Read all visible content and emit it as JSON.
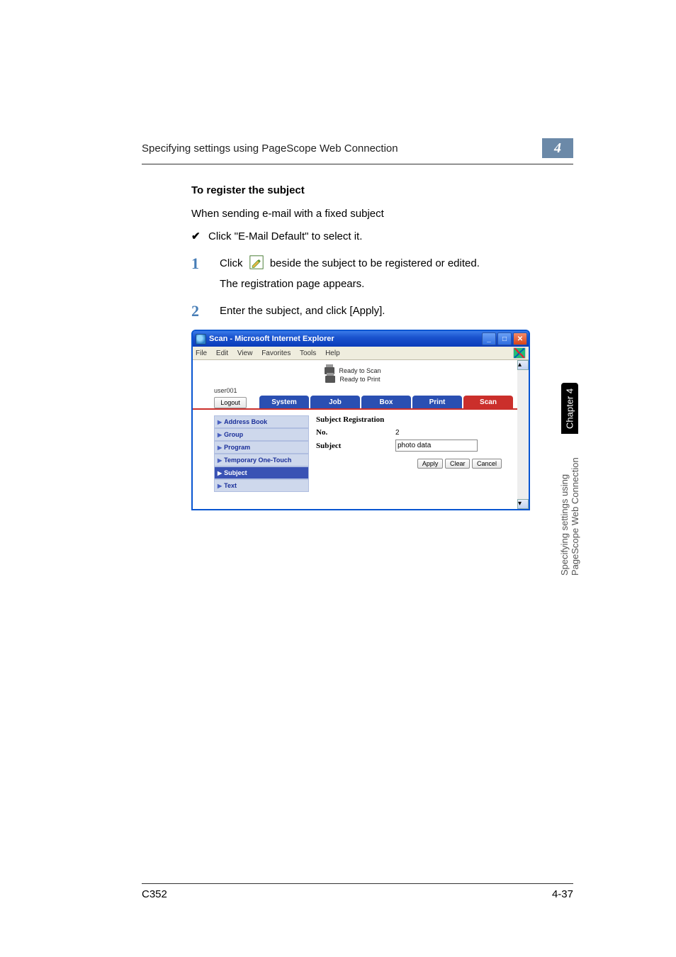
{
  "header": {
    "running_head": "Specifying settings using PageScope Web Connection",
    "chapter_num": "4"
  },
  "doc": {
    "section_title": "To register the subject",
    "intro": "When sending e-mail with a fixed subject",
    "check_text": "Click \"E-Mail Default\" to select it.",
    "step1_a": "Click ",
    "step1_b": " beside the subject to be registered or edited.",
    "step1_sub": "The registration page appears.",
    "step2": "Enter the subject, and click [Apply]."
  },
  "browser": {
    "title": "Scan - Microsoft Internet Explorer",
    "menus": [
      "File",
      "Edit",
      "View",
      "Favorites",
      "Tools",
      "Help"
    ],
    "status1": "Ready to Scan",
    "status2": "Ready to Print",
    "username": "user001",
    "logout": "Logout",
    "tabs": [
      "System",
      "Job",
      "Box",
      "Print",
      "Scan"
    ],
    "active_tab": 4,
    "sidebar": [
      "Address Book",
      "Group",
      "Program",
      "Temporary One-Touch",
      "Subject",
      "Text"
    ],
    "sidebar_selected": 4,
    "panel_title": "Subject Registration",
    "form": {
      "no_label": "No.",
      "no_value": "2",
      "subject_label": "Subject",
      "subject_value": "photo data"
    },
    "buttons": {
      "apply": "Apply",
      "clear": "Clear",
      "cancel": "Cancel"
    }
  },
  "side_tab": {
    "black": "Chapter 4",
    "gray": "Specifying settings using PageScope Web Connection"
  },
  "footer": {
    "left": "C352",
    "right": "4-37"
  }
}
